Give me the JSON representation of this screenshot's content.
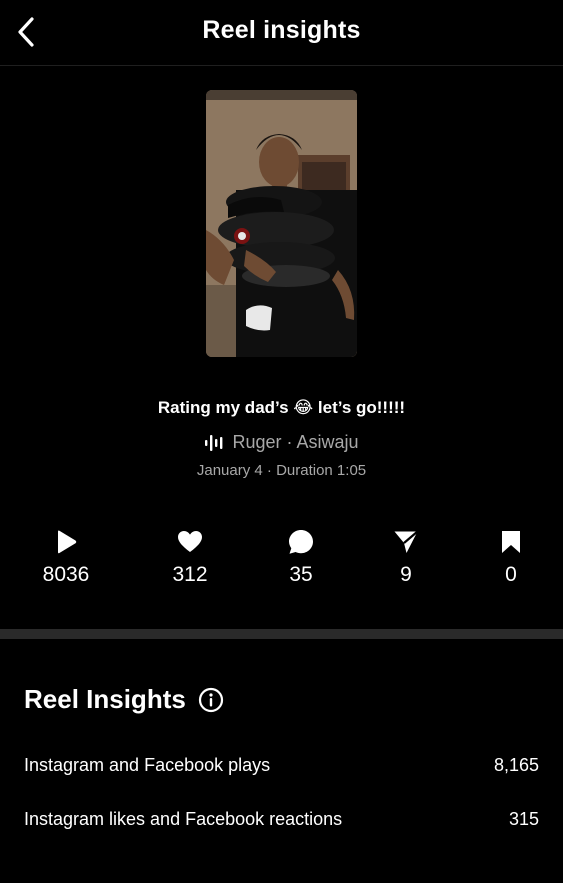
{
  "header": {
    "title": "Reel insights",
    "back_icon": "chevron-left-icon"
  },
  "reel": {
    "caption": "Rating my dad’s 😂 let’s go!!!!!",
    "audio": "Ruger · Asiwaju",
    "audio_icon": "waveform-icon",
    "meta": "January 4 · Duration 1:05"
  },
  "stats": [
    {
      "icon": "play-icon",
      "value": "8036"
    },
    {
      "icon": "heart-icon",
      "value": "312"
    },
    {
      "icon": "comment-icon",
      "value": "35"
    },
    {
      "icon": "share-icon",
      "value": "9"
    },
    {
      "icon": "bookmark-icon",
      "value": "0"
    }
  ],
  "insights": {
    "title": "Reel Insights",
    "info_icon": "info-icon",
    "rows": [
      {
        "label": "Instagram and Facebook plays",
        "value": "8,165"
      },
      {
        "label": "Instagram likes and Facebook reactions",
        "value": "315"
      }
    ]
  },
  "colors": {
    "background": "#000000",
    "secondary_text": "#a8a8a8",
    "divider": "#2a2a2a"
  }
}
